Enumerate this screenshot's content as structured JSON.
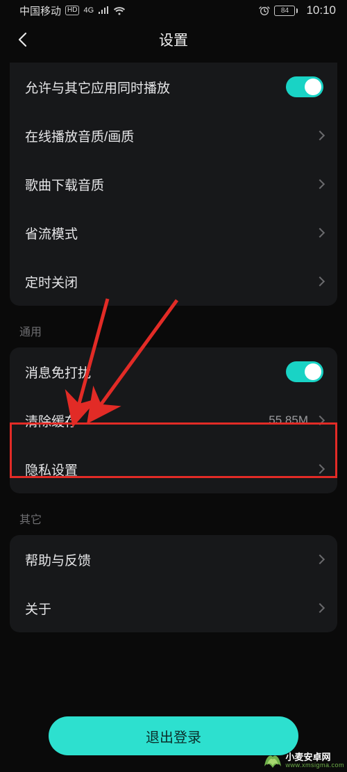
{
  "status": {
    "carrier": "中国移动",
    "hd": "HD",
    "net": "4G",
    "battery": "84",
    "time": "10:10"
  },
  "nav": {
    "title": "设置"
  },
  "group1": {
    "allow_other_play": "允许与其它应用同时播放",
    "online_quality": "在线播放音质/画质",
    "download_quality": "歌曲下载音质",
    "data_saver": "省流模式",
    "timer_off": "定时关闭"
  },
  "section_general": "通用",
  "group2": {
    "dnd": "消息免打扰",
    "clear_cache": "清除缓存",
    "cache_size": "55.85M",
    "privacy": "隐私设置"
  },
  "section_other": "其它",
  "group3": {
    "help": "帮助与反馈",
    "about": "关于"
  },
  "logout": "退出登录",
  "watermark": {
    "name": "小麦安卓网",
    "url": "www.xmsigma.com"
  }
}
